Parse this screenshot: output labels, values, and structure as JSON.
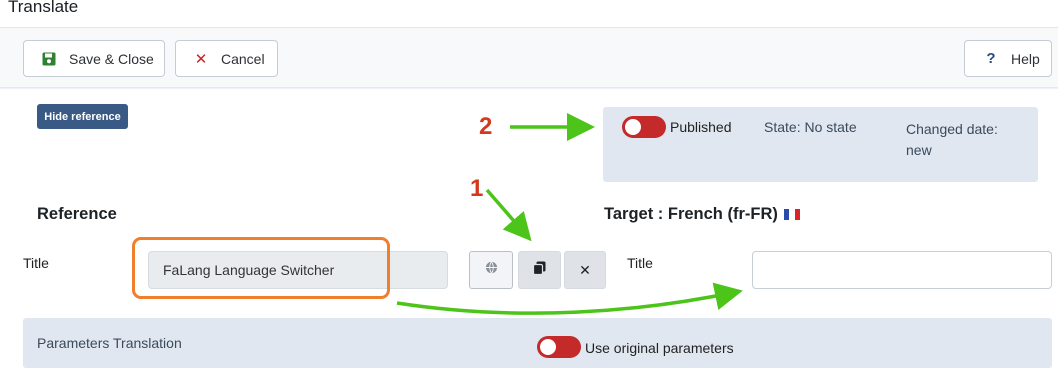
{
  "window": {
    "title": "Translate"
  },
  "toolbar": {
    "save_close": "Save & Close",
    "cancel": "Cancel",
    "help": "Help"
  },
  "hide_reference": "Hide reference",
  "status": {
    "published_label": "Published",
    "published_on": false,
    "state": "State: No state",
    "changed_date": "Changed date: new"
  },
  "reference": {
    "heading": "Reference",
    "title_label": "Title",
    "title_value": "FaLang Language Switcher"
  },
  "target": {
    "heading": "Target : French (fr-FR)",
    "title_label": "Title",
    "title_value": ""
  },
  "params": {
    "label": "Parameters Translation",
    "use_original": "Use original parameters",
    "use_original_on": false
  },
  "annotations": {
    "step1": "1",
    "step2": "2"
  },
  "colors": {
    "toggle_off": "#c42a2a",
    "hide_reference_bg": "#3a5a86",
    "highlight": "#f07f2c",
    "arrow": "#4cc419",
    "step_number": "#d13a1a"
  },
  "icons": {
    "save": "floppy-disk-icon",
    "cancel": "close-icon",
    "help": "question-icon",
    "globe": "globe-icon",
    "copy": "copy-icon",
    "clear": "close-icon",
    "flag": "french-flag-icon"
  }
}
